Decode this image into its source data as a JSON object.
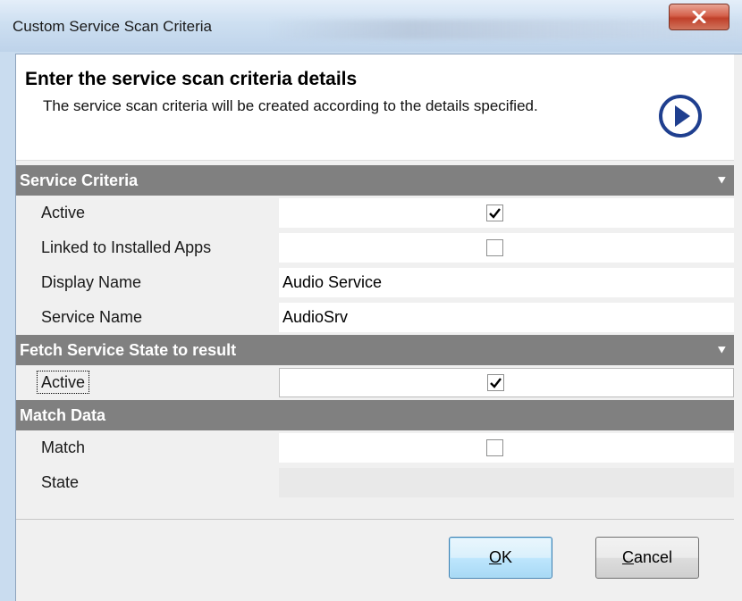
{
  "window": {
    "title": "Custom Service Scan Criteria"
  },
  "header": {
    "title": "Enter the service scan criteria details",
    "description": "The service scan criteria will be created according to the details specified.",
    "icon": "next-arrow-icon"
  },
  "sections": {
    "service_criteria": {
      "title": "Service Criteria",
      "rows": {
        "active": {
          "label": "Active",
          "checked": true
        },
        "linked": {
          "label": "Linked to Installed Apps",
          "checked": false
        },
        "display_name": {
          "label": "Display Name",
          "value": "Audio Service"
        },
        "service_name": {
          "label": "Service Name",
          "value": "AudioSrv"
        }
      }
    },
    "fetch_state": {
      "title": "Fetch Service State to result",
      "rows": {
        "active": {
          "label": "Active",
          "checked": true
        }
      }
    },
    "match_data": {
      "title": "Match Data",
      "rows": {
        "match": {
          "label": "Match",
          "checked": false
        },
        "state": {
          "label": "State",
          "value": ""
        }
      }
    }
  },
  "buttons": {
    "ok": {
      "mnemonic": "O",
      "rest": "K"
    },
    "cancel": {
      "mnemonic": "C",
      "rest": "ancel"
    }
  },
  "colors": {
    "section_header": "#808080",
    "accent_blue": "#1f3f8f",
    "close_red": "#c0402a"
  }
}
